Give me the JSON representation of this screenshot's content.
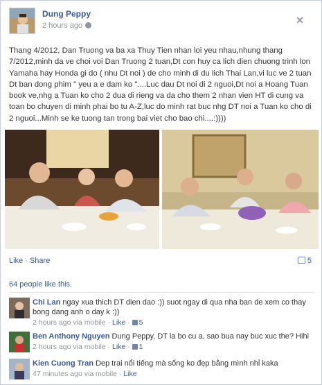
{
  "post": {
    "author": "Dung Peppy",
    "time": "2 hours ago",
    "text": "Thang 4/2012, Dan Truong va ba xa Thuy Tien nhan loi yeu nhau,nhung thang 7/2012,minh da ve choi voi Dan Truong 2 tuan,Dt con huy ca lich dien chuong trinh lon Yamaha hay Honda gi do ( nhu Dt noi ) de cho minh di du lich Thai Lan,vi luc ve 2 tuan Dt ban dong phim \" yeu a e dam ko \"....Luc dau Dt noi di 2 nguoi,Dt noi a Hoang Tuan book ve,nhg a Tuan ko cho 2 dua di rieng va da cho them 2 nhan vien HT di cung va toan bo chuyen di minh phai bo tu A-Z,luc do minh rat buc nhg DT noi a Tuan ko cho di 2 nguoi...Minh se ke tuong tan trong bai viet cho bao chi....:))))",
    "close_symbol": "✕",
    "like_label": "Like",
    "share_label": "Share",
    "separator": " · ",
    "comment_count": "5",
    "likes_text": "64 people like this."
  },
  "comments": [
    {
      "name": "Chi Lan",
      "text": "ngay xua thich DT dien dao :)) suot ngay di qua nha ban de xem co thay bong dang anh o day k :))",
      "time": "2 hours ago via mobile",
      "like": "Like",
      "likes": "5"
    },
    {
      "name": "Ben Anthony Nguyen",
      "text": "Dung Peppy, DT la bo cu a, sao bua nay buc xuc the? Hihi",
      "time": "2 hours ago via mobile",
      "like": "Like",
      "likes": "1"
    },
    {
      "name": "Kien Cuong Tran",
      "text": "Dep trai nổi tiếng mà sống ko đẹp bằng mình nhỉ kaka",
      "time": "47 minutes ago via mobile",
      "like": "Like",
      "likes": ""
    }
  ],
  "colors": {
    "link": "#3b5998",
    "meta": "#90949c",
    "border": "#c4cde0"
  }
}
